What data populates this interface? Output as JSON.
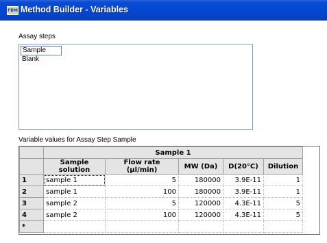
{
  "window": {
    "title": "Method Builder - Variables",
    "icon_text": "FBM"
  },
  "assay_steps": {
    "label": "Assay steps",
    "items": [
      "Sample",
      "Blank"
    ],
    "selected": "Sample"
  },
  "variables": {
    "label": "Variable values for Assay Step Sample",
    "group_header": "Sample 1",
    "columns": [
      "Sample solution",
      "Flow rate (µl/min)",
      "MW (Da)",
      "D(20°C)",
      "Dilution"
    ],
    "rows": [
      {
        "num": "1",
        "cells": [
          "sample 1",
          "5",
          "180000",
          "3.9E-11",
          "1"
        ]
      },
      {
        "num": "2",
        "cells": [
          "sample 1",
          "100",
          "180000",
          "3.9E-11",
          "1"
        ]
      },
      {
        "num": "3",
        "cells": [
          "sample 2",
          "5",
          "120000",
          "4.3E-11",
          "5"
        ]
      },
      {
        "num": "4",
        "cells": [
          "sample 2",
          "100",
          "120000",
          "4.3E-11",
          "5"
        ]
      }
    ],
    "new_row_marker": "*"
  }
}
